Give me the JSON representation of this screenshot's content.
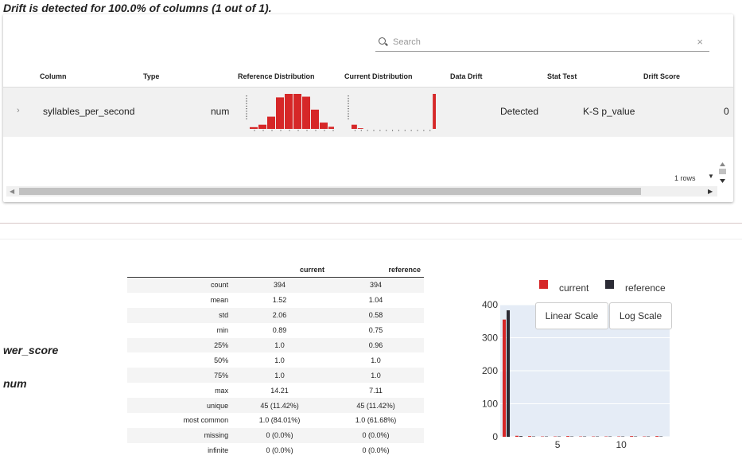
{
  "title": "Drift is detected for 100.0% of columns (1 out of 1).",
  "search": {
    "placeholder": "Search",
    "clear": "×"
  },
  "table": {
    "headers": [
      "Column",
      "Type",
      "Reference Distribution",
      "Current Distribution",
      "Data Drift",
      "Stat Test",
      "Drift Score"
    ],
    "row": {
      "column": "syllables_per_second",
      "type": "num",
      "data_drift": "Detected",
      "stat_test": "K-S p_value",
      "drift_score": "0"
    },
    "rows_label": "1 rows",
    "expand_glyph": "›"
  },
  "spark": {
    "reference": [
      0.05,
      0.12,
      0.35,
      0.9,
      1.0,
      1.0,
      0.92,
      0.55,
      0.18,
      0.06
    ],
    "current": [
      0.12,
      0.02,
      0,
      0,
      0,
      0,
      0,
      0,
      0,
      0,
      0,
      0,
      0,
      1.0
    ]
  },
  "detail": {
    "column_name": "wer_score",
    "column_type": "num",
    "stats_headers": [
      "",
      "current",
      "reference"
    ],
    "stats_rows": [
      [
        "count",
        "394",
        "394"
      ],
      [
        "mean",
        "1.52",
        "1.04"
      ],
      [
        "std",
        "2.06",
        "0.58"
      ],
      [
        "min",
        "0.89",
        "0.75"
      ],
      [
        "25%",
        "1.0",
        "0.96"
      ],
      [
        "50%",
        "1.0",
        "1.0"
      ],
      [
        "75%",
        "1.0",
        "1.0"
      ],
      [
        "max",
        "14.21",
        "7.11"
      ],
      [
        "unique",
        "45 (11.42%)",
        "45 (11.42%)"
      ],
      [
        "most common",
        "1.0 (84.01%)",
        "1.0 (61.68%)"
      ],
      [
        "missing",
        "0 (0.0%)",
        "0 (0.0%)"
      ],
      [
        "infinite",
        "0 (0.0%)",
        "0 (0.0%)"
      ]
    ],
    "buttons": {
      "linear": "Linear Scale",
      "log": "Log Scale"
    }
  },
  "colors": {
    "current": "#d62728",
    "reference": "#2b2b35",
    "plot_bg": "#e5ecf6"
  },
  "chart_data": {
    "type": "bar",
    "x": [
      1,
      2,
      3,
      4,
      5,
      6,
      7,
      8,
      9,
      10,
      11,
      12,
      13
    ],
    "series": [
      {
        "name": "current",
        "values": [
          355,
          3,
          2,
          1,
          1,
          2,
          1,
          1,
          1,
          1,
          2,
          1,
          2
        ]
      },
      {
        "name": "reference",
        "values": [
          383,
          2,
          1,
          1,
          1,
          1,
          1,
          1,
          1,
          1,
          1,
          1,
          1
        ]
      }
    ],
    "yticks": [
      "0",
      "100",
      "200",
      "300",
      "400"
    ],
    "xticks": [
      "5",
      "10"
    ],
    "ylim": [
      0,
      400
    ],
    "legend": "top",
    "grid": true
  }
}
